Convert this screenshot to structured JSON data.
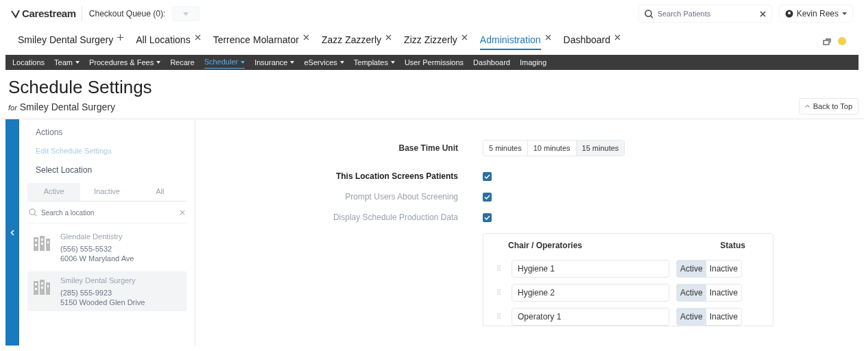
{
  "header": {
    "logo": "Carestream",
    "checkout_queue": "Checkout Queue (0):",
    "search": {
      "placeholder": "Search Patients"
    },
    "user": "Kevin Rees"
  },
  "tabs": [
    {
      "label": "Smiley Dental Surgery",
      "kind": "add",
      "selected": false
    },
    {
      "label": "All Locations",
      "kind": "close",
      "selected": false
    },
    {
      "label": "Terrence Molarnator",
      "kind": "close",
      "selected": false
    },
    {
      "label": "Zazz Zazzerly",
      "kind": "close",
      "selected": false
    },
    {
      "label": "Zizz Zizzerly",
      "kind": "close",
      "selected": false
    },
    {
      "label": "Administration",
      "kind": "close",
      "selected": true
    },
    {
      "label": "Dashboard",
      "kind": "close",
      "selected": false
    }
  ],
  "nav": [
    {
      "label": "Locations",
      "dropdown": false,
      "selected": false
    },
    {
      "label": "Team",
      "dropdown": true,
      "selected": false
    },
    {
      "label": "Procedures & Fees",
      "dropdown": true,
      "selected": false
    },
    {
      "label": "Recare",
      "dropdown": false,
      "selected": false
    },
    {
      "label": "Scheduler",
      "dropdown": true,
      "selected": true
    },
    {
      "label": "Insurance",
      "dropdown": true,
      "selected": false
    },
    {
      "label": "eServices",
      "dropdown": true,
      "selected": false
    },
    {
      "label": "Templates",
      "dropdown": true,
      "selected": false
    },
    {
      "label": "User Permissions",
      "dropdown": false,
      "selected": false
    },
    {
      "label": "Dashboard",
      "dropdown": false,
      "selected": false
    },
    {
      "label": "Imaging",
      "dropdown": false,
      "selected": false
    }
  ],
  "page": {
    "title": "Schedule Settings",
    "subtitle_prefix": "for",
    "subtitle": "Smiley Dental Surgery",
    "back_to_top": "Back to Top"
  },
  "sidebar": {
    "actions_heading": "Actions",
    "actions": [
      "Edit Schedule Settings"
    ],
    "select_heading": "Select Location",
    "filters": [
      {
        "label": "Active",
        "selected": true
      },
      {
        "label": "Inactive",
        "selected": false
      },
      {
        "label": "All",
        "selected": false
      }
    ],
    "search": {
      "placeholder": "Search a location"
    },
    "locations": [
      {
        "name": "Glendale Dentistry",
        "phone": "(556) 555-5532",
        "address": "6006 W Maryland Ave",
        "selected": false
      },
      {
        "name": "Smiley Dental Surgery",
        "phone": "(285) 555-9923",
        "address": "5150 Wooded Glen Drive",
        "selected": true
      }
    ]
  },
  "settings": {
    "base_time_unit": {
      "label": "Base Time Unit",
      "options": [
        {
          "label": "5 minutes",
          "selected": false
        },
        {
          "label": "10 minutes",
          "selected": false
        },
        {
          "label": "15 minutes",
          "selected": true
        }
      ]
    },
    "checks": [
      {
        "label": "This Location Screens Patients",
        "emphasis": true,
        "checked": true
      },
      {
        "label": "Prompt Users About Screening",
        "emphasis": false,
        "checked": true
      },
      {
        "label": "Display Schedule Production Data",
        "emphasis": false,
        "checked": true
      }
    ]
  },
  "chairs": {
    "columns": [
      "Chair / Operatories",
      "Status"
    ],
    "rows": [
      {
        "name": "Hygiene 1",
        "status_options": [
          "Active",
          "Inactive"
        ],
        "active": true
      },
      {
        "name": "Hygiene 2",
        "status_options": [
          "Active",
          "Inactive"
        ],
        "active": true
      },
      {
        "name": "Operatory 1",
        "status_options": [
          "Active",
          "Inactive"
        ],
        "active": true
      }
    ]
  }
}
